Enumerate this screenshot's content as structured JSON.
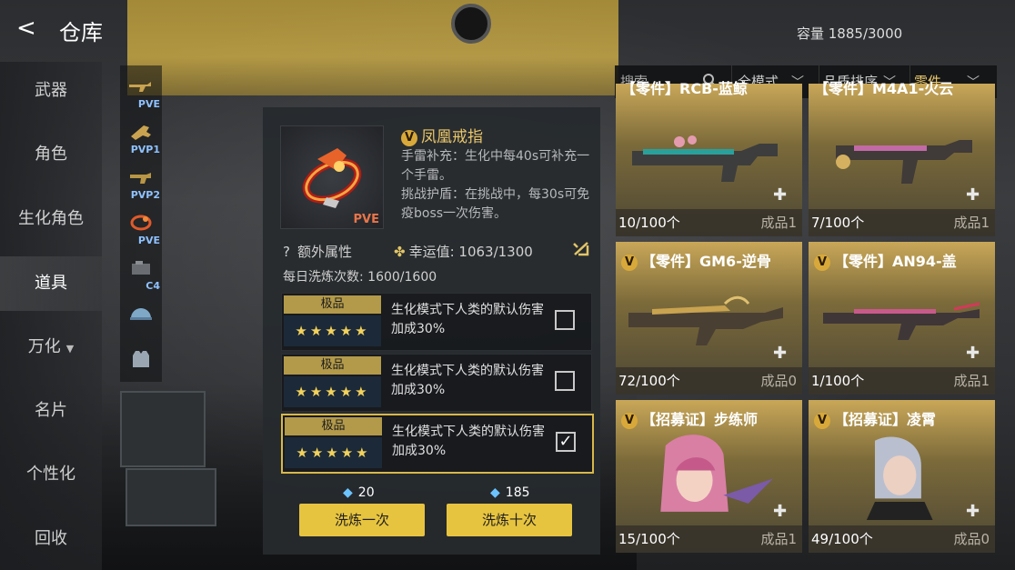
{
  "header": {
    "back": "<",
    "title": "仓库",
    "capacity": "容量 1885/3000"
  },
  "nav": {
    "items": [
      {
        "label": "武器"
      },
      {
        "label": "角色"
      },
      {
        "label": "生化角色"
      },
      {
        "label": "道具",
        "active": true
      },
      {
        "label": "万化",
        "caret": "▼"
      },
      {
        "label": "名片"
      },
      {
        "label": "个性化"
      },
      {
        "label": "回收"
      }
    ]
  },
  "categories": [
    {
      "label": "PVE",
      "icon": "gun-icon"
    },
    {
      "label": "PVP1",
      "icon": "gun-icon"
    },
    {
      "label": "PVP2",
      "icon": "gun-icon"
    },
    {
      "label": "PVE",
      "icon": "ring-icon"
    },
    {
      "label": "C4",
      "icon": "bomb-icon"
    },
    {
      "label": "",
      "icon": "helmet-icon"
    },
    {
      "label": "",
      "icon": "vest-icon"
    }
  ],
  "item": {
    "badge": "V",
    "name": "凤凰戒指",
    "tag": "PVE",
    "desc1": "手雷补充：生化中每40s可补充一个手雷。",
    "desc2": "挑战护盾：在挑战中，每30s可免疫boss一次伤害。",
    "extra_icon": "?",
    "extra": "额外属性",
    "luck_label": "幸运值: 1063/1300",
    "daily": "每日洗炼次数: 1600/1600"
  },
  "attributes": [
    {
      "grade": "极品",
      "stars": "★★★★★",
      "text": "生化模式下人类的默认伤害加成30%",
      "checked": false
    },
    {
      "grade": "极品",
      "stars": "★★★★★",
      "text": "生化模式下人类的默认伤害加成30%",
      "checked": false
    },
    {
      "grade": "极品",
      "stars": "★★★★★",
      "text": "生化模式下人类的默认伤害加成30%",
      "checked": true
    }
  ],
  "actions": {
    "cost1": "20",
    "btn1": "洗炼一次",
    "cost10": "185",
    "btn10": "洗炼十次"
  },
  "filters": {
    "search_placeholder": "搜索",
    "mode": "全模式",
    "sort": "品质排序",
    "type": "零件"
  },
  "cards": [
    {
      "name": "【零件】RCB-蓝鲸",
      "count": "10/100个",
      "status": "成品1",
      "accent": "#c8a557"
    },
    {
      "name": "【零件】M4A1-火云",
      "count": "7/100个",
      "status": "成品1",
      "accent": "#c8a557"
    },
    {
      "name": "【零件】GM6-逆骨",
      "count": "72/100个",
      "status": "成品0",
      "accent": "#c8a557"
    },
    {
      "name": "【零件】AN94-盖",
      "count": "1/100个",
      "status": "成品1",
      "accent": "#c8a557"
    },
    {
      "name": "【招募证】步练师",
      "count": "15/100个",
      "status": "成品1",
      "accent": "#c8a557"
    },
    {
      "name": "【招募证】凌霄",
      "count": "49/100个",
      "status": "成品0",
      "accent": "#c8a557"
    }
  ]
}
